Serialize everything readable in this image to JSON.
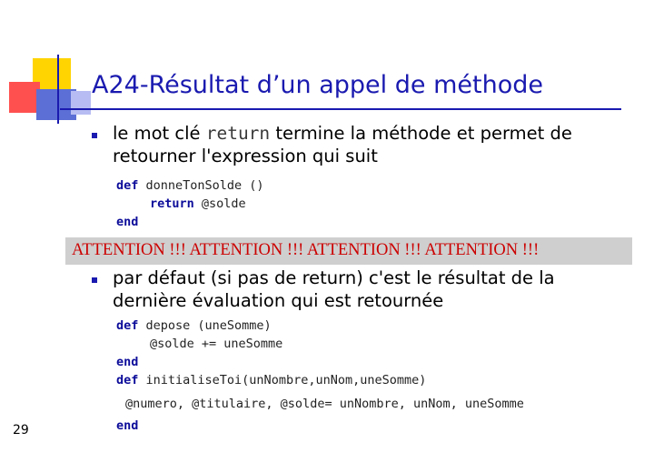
{
  "slide": {
    "title": "A24-Résultat d’un appel de méthode",
    "page_number": "29"
  },
  "bullet1": {
    "text_before": "le mot clé ",
    "keyword": "return",
    "text_after": " termine la méthode et permet de",
    "line2": "retourner l'expression qui suit"
  },
  "code1": {
    "line1_kw": "def",
    "line1_text": " donneTonSolde ()",
    "line2_kw": "return",
    "line2_text": " @solde",
    "line3_kw": "end"
  },
  "banner": {
    "text": "ATTENTION !!! ATTENTION !!! ATTENTION !!! ATTENTION !!!"
  },
  "bullet2": {
    "line1": "par défaut (si pas de return) c'est le résultat de la",
    "line2": "dernière évaluation qui est retournée"
  },
  "code2": {
    "line1_kw": "def",
    "line1_text": " depose (uneSomme)",
    "line2_text": "@solde += uneSomme",
    "line3_kw": "end",
    "line4_kw": "def",
    "line4_text": " initialiseToi(unNombre,unNom,uneSomme)",
    "line5_text": "@numero, @titulaire, @solde= unNombre, unNom, uneSomme",
    "line6_kw": "end"
  },
  "colors": {
    "title": "#1a1ab0",
    "banner_text": "#cc0000",
    "banner_bg": "#cfcfcf",
    "keyword": "#0c0c9a"
  }
}
